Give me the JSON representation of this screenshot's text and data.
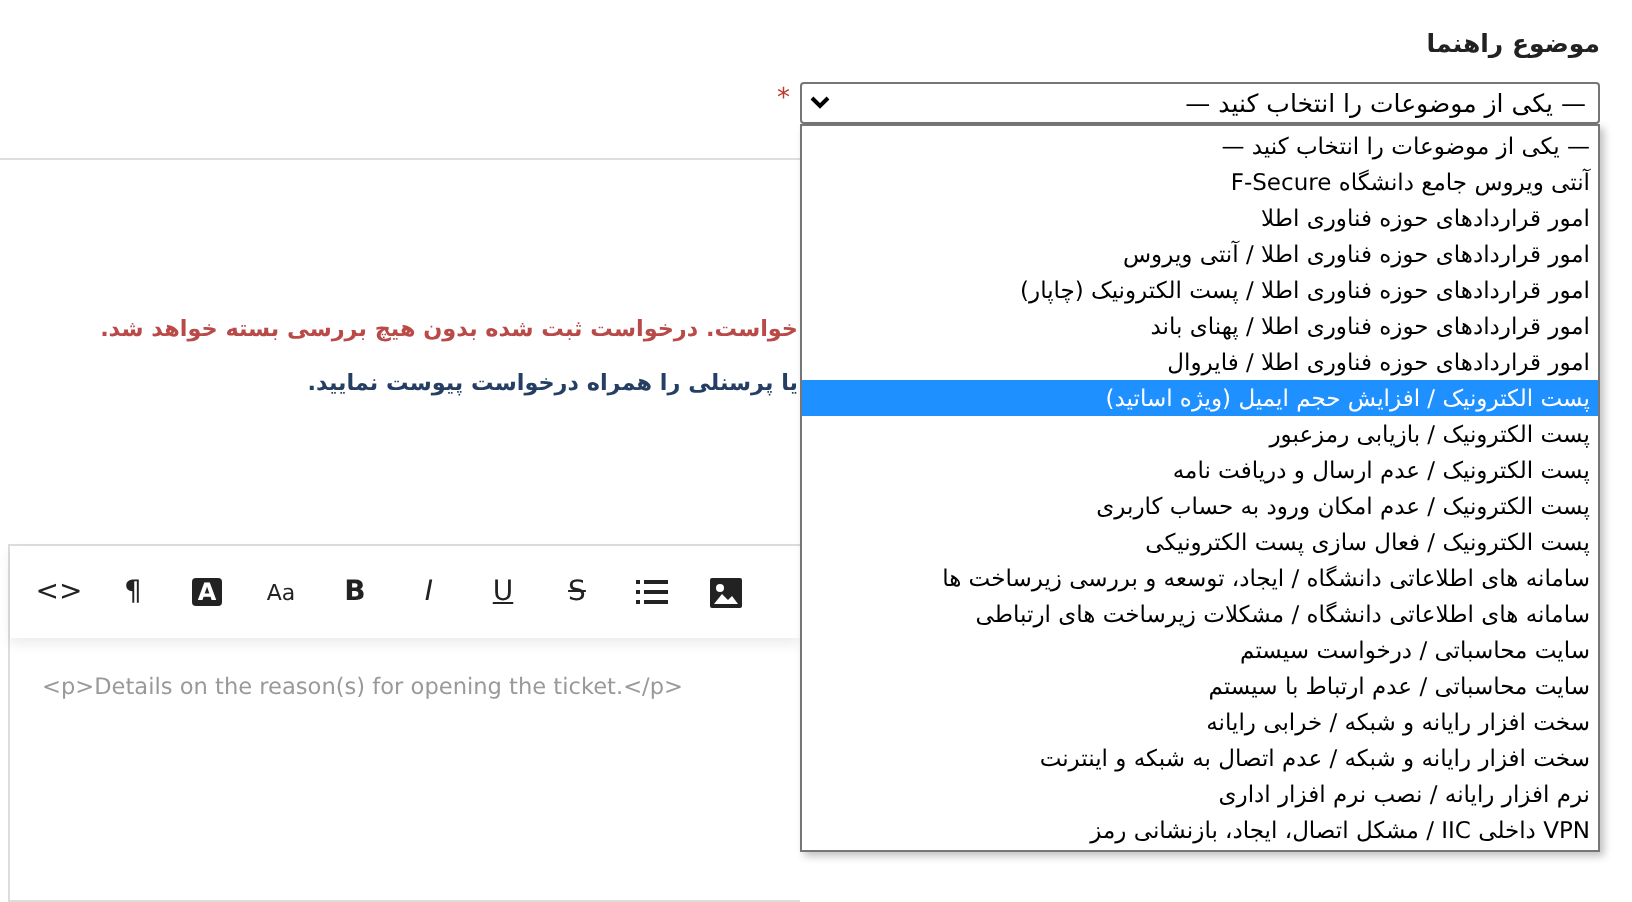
{
  "topic": {
    "label": "موضوع راهنما",
    "required_mark": "*",
    "value": "— یکی از موضوعات را انتخاب کنید —",
    "expanded": true,
    "options": [
      {
        "label": "— یکی از موضوعات را انتخاب کنید —",
        "highlighted": false
      },
      {
        "label": "آنتی ویروس جامع دانشگاه F-Secure",
        "highlighted": false
      },
      {
        "label": "امور قراردادهای حوزه فناوری اطلا",
        "highlighted": false
      },
      {
        "label": "امور قراردادهای حوزه فناوری اطلا / آنتی ویروس",
        "highlighted": false
      },
      {
        "label": "امور قراردادهای حوزه فناوری اطلا / پست الکترونیک (چاپار)",
        "highlighted": false
      },
      {
        "label": "امور قراردادهای حوزه فناوری اطلا / پهنای باند",
        "highlighted": false
      },
      {
        "label": "امور قراردادهای حوزه فناوری اطلا / فایروال",
        "highlighted": false
      },
      {
        "label": "پست الکترونیک / افزایش حجم ایمیل (ویژه اساتید)",
        "highlighted": true
      },
      {
        "label": "پست الکترونیک / بازیابی رمزعبور",
        "highlighted": false
      },
      {
        "label": "پست الکترونیک / عدم ارسال و دریافت نامه",
        "highlighted": false
      },
      {
        "label": "پست الکترونیک / عدم امکان ورود به حساب کاربری",
        "highlighted": false
      },
      {
        "label": "پست الکترونیک / فعال سازی پست الکترونیکی",
        "highlighted": false
      },
      {
        "label": "سامانه های اطلاعاتی دانشگاه / ایجاد، توسعه و بررسی زیرساخت ها",
        "highlighted": false
      },
      {
        "label": "سامانه های اطلاعاتی دانشگاه / مشکلات زیرساخت های ارتباطی",
        "highlighted": false
      },
      {
        "label": "سایت محاسباتی / درخواست سیستم",
        "highlighted": false
      },
      {
        "label": "سایت محاسباتی / عدم ارتباط با سیستم",
        "highlighted": false
      },
      {
        "label": "سخت افزار رایانه و شبکه / خرابی رایانه",
        "highlighted": false
      },
      {
        "label": "سخت افزار رایانه و شبکه / عدم اتصال به شبکه و اینترنت",
        "highlighted": false
      },
      {
        "label": "نرم افزار رایانه / نصب نرم افزار اداری",
        "highlighted": false
      },
      {
        "label": "VPN داخلی IIC / مشکل اتصال، ایجاد، بازنشانی رمز",
        "highlighted": false
      }
    ]
  },
  "notices": [
    {
      "kind": "warning",
      "text": "خواست. درخواست ثبت شده بدون هیچ بررسی بسته خواهد شد."
    },
    {
      "kind": "info",
      "text": "یا پرسنلی را همراه درخواست پیوست نمایید."
    }
  ],
  "editor": {
    "toolbar": [
      {
        "kind": "image"
      },
      {
        "kind": "list"
      },
      {
        "kind": "strike",
        "label": "S"
      },
      {
        "kind": "underline",
        "label": "U"
      },
      {
        "kind": "italic",
        "label": "I"
      },
      {
        "kind": "bold",
        "label": "B"
      },
      {
        "kind": "font-size",
        "label": "Aa"
      },
      {
        "kind": "color",
        "label": "A"
      },
      {
        "kind": "paragraph",
        "label": "¶"
      },
      {
        "kind": "code",
        "label": "<>"
      }
    ],
    "placeholder": "<p>Details on the reason(s) for opening the ticket.</p>"
  }
}
